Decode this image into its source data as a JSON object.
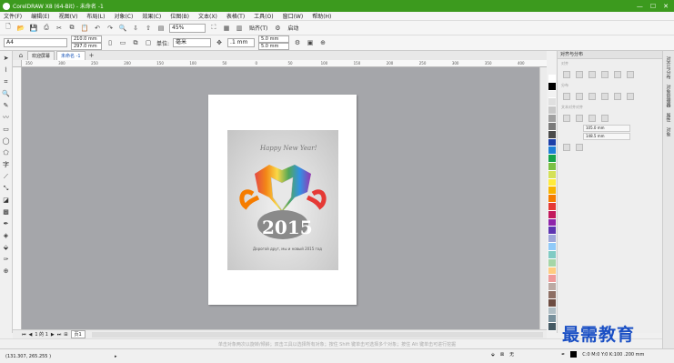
{
  "window": {
    "title": "CorelDRAW X8 (64-Bit) - 未命名 -1",
    "controls": [
      "—",
      "☐",
      "✕"
    ]
  },
  "menu": [
    "文件(F)",
    "编辑(E)",
    "视图(V)",
    "布局(L)",
    "对象(C)",
    "效果(C)",
    "位图(B)",
    "文本(X)",
    "表格(T)",
    "工具(O)",
    "窗口(W)",
    "帮助(H)"
  ],
  "toolbar": {
    "zoom": "45%",
    "snap_label": "贴齐(T)",
    "launch_label": "启动"
  },
  "property_bar": {
    "page_size": "A4",
    "width": "210.0 mm",
    "height": "297.0 mm",
    "units_label": "单位:",
    "units": "毫米",
    "nudge": ".1 mm",
    "dup_x": "5.0 mm",
    "dup_y": "5.0 mm"
  },
  "tabs": [
    {
      "label": "欢迎屏幕",
      "active": false
    },
    {
      "label": "未命名 -1",
      "active": true
    }
  ],
  "ruler_ticks": [
    "350",
    "300",
    "250",
    "200",
    "150",
    "100",
    "50",
    "0",
    "50",
    "100",
    "150",
    "200",
    "250",
    "300",
    "350",
    "400"
  ],
  "artwork": {
    "greeting": "Happy New Year!",
    "year": "2015",
    "tagline": "Дорогой друг, мы и новый 2015 год"
  },
  "page_nav": {
    "position": "1 的 1",
    "page_tab": "页1"
  },
  "status": {
    "coords": "(131.307, 265.255 )",
    "hint": "单击对象两次以旋转/倾斜；双击工具以选择所有对象；按住 Shift 键单击可选择多个对象；按住 Alt 键单击可进行挖掘",
    "fill_label": "无",
    "color_info": "C:0 M:0 Y:0 K:100  .200 mm"
  },
  "docker": {
    "title": "对齐与分布",
    "section_align": "对齐",
    "section_distribute": "分布",
    "section_textalign": "文本对齐对齐",
    "field1": "105.0 mm",
    "field2": "148.5 mm"
  },
  "side_tabs": [
    "对齐与分布",
    "对象管理器",
    "属性",
    "对象"
  ],
  "palette_colors": [
    "#ffffff",
    "#000000",
    "#f2f2f2",
    "#e0e0e0",
    "#c8c8c8",
    "#a0a0a0",
    "#7a7a7a",
    "#4a4a4a",
    "#1c3fa8",
    "#1e7fd6",
    "#16a34a",
    "#7bc043",
    "#d4e157",
    "#ffeb3b",
    "#f8b400",
    "#f57c00",
    "#e53935",
    "#c2185b",
    "#8e24aa",
    "#5e35b1",
    "#9fa8da",
    "#90caf9",
    "#80cbc4",
    "#a5d6a7",
    "#ffcc80",
    "#ef9a9a",
    "#bcaaa4",
    "#8d6e63",
    "#6d4c41",
    "#b0bec5",
    "#78909c",
    "#455a64"
  ],
  "watermark": "最需教育"
}
